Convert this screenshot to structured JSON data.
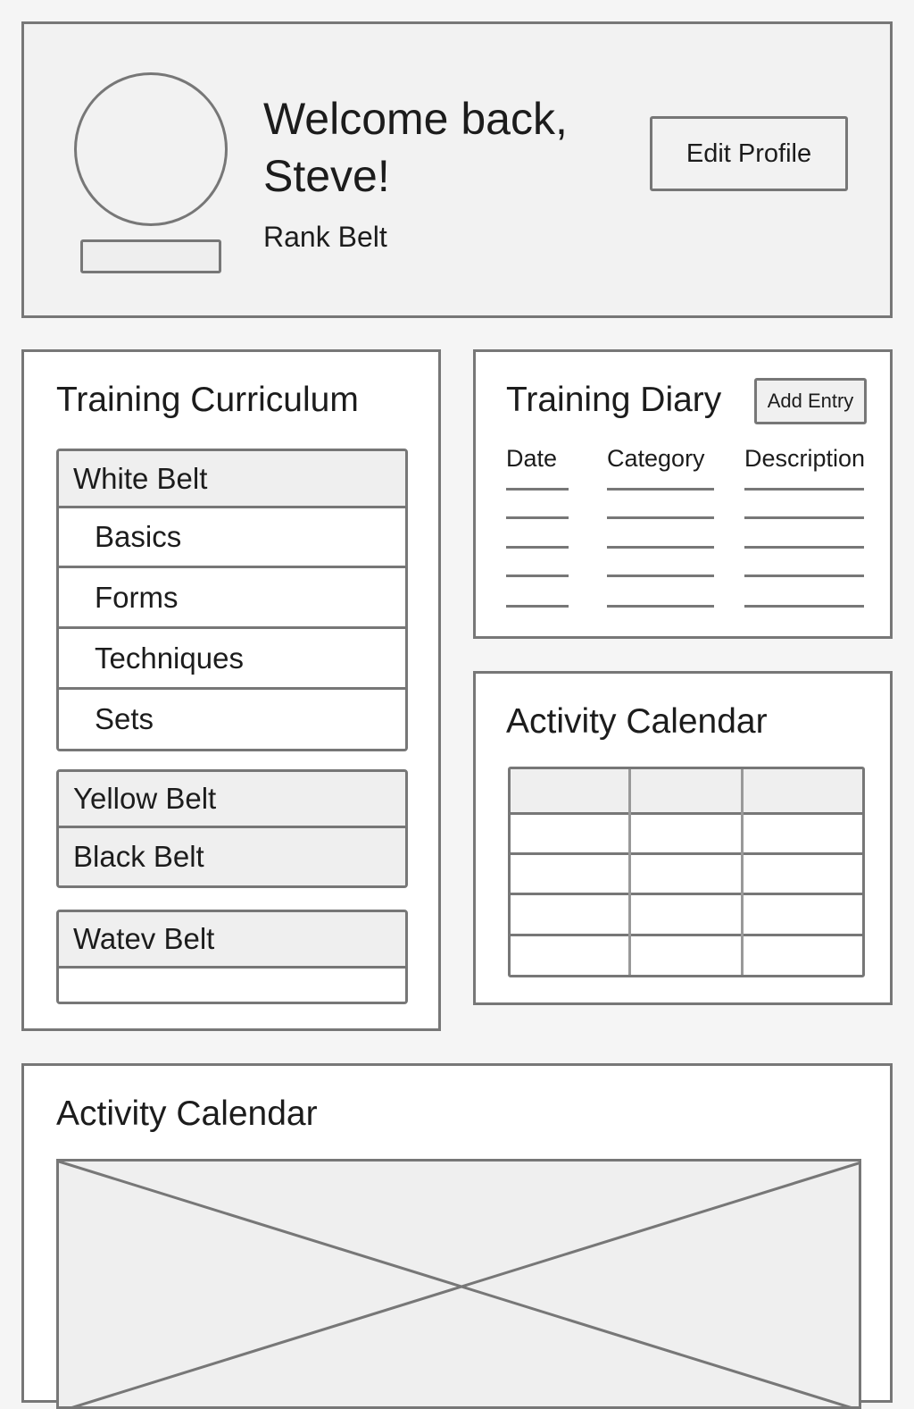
{
  "header": {
    "welcome": "Welcome back, Steve!",
    "rank_label": "Rank Belt",
    "edit_profile_label": "Edit Profile"
  },
  "curriculum": {
    "title": "Training Curriculum",
    "groups": [
      {
        "belt": "White Belt",
        "items": [
          "Basics",
          "Forms",
          "Techniques",
          "Sets"
        ]
      },
      {
        "belt": "Yellow Belt",
        "items": []
      },
      {
        "belt": "Black Belt",
        "items": []
      },
      {
        "belt": "Watev Belt",
        "items": [
          ""
        ]
      }
    ]
  },
  "diary": {
    "title": "Training Diary",
    "add_entry_label": "Add Entry",
    "columns": [
      "Date",
      "Category",
      "Description"
    ],
    "rows": [
      [
        "",
        "",
        ""
      ],
      [
        "",
        "",
        ""
      ],
      [
        "",
        "",
        ""
      ],
      [
        "",
        "",
        ""
      ],
      [
        "",
        "",
        ""
      ]
    ]
  },
  "calendar_small": {
    "title": "Activity Calendar"
  },
  "calendar_large": {
    "title": "Activity Calendar"
  },
  "colors": {
    "border": "#777777",
    "panel_bg": "#ffffff",
    "header_bg": "#f2f2f2",
    "row_header_bg": "#efefef",
    "page_bg": "#f5f5f5"
  },
  "icons": {
    "avatar": "user-avatar-placeholder",
    "image": "image-placeholder-icon"
  }
}
